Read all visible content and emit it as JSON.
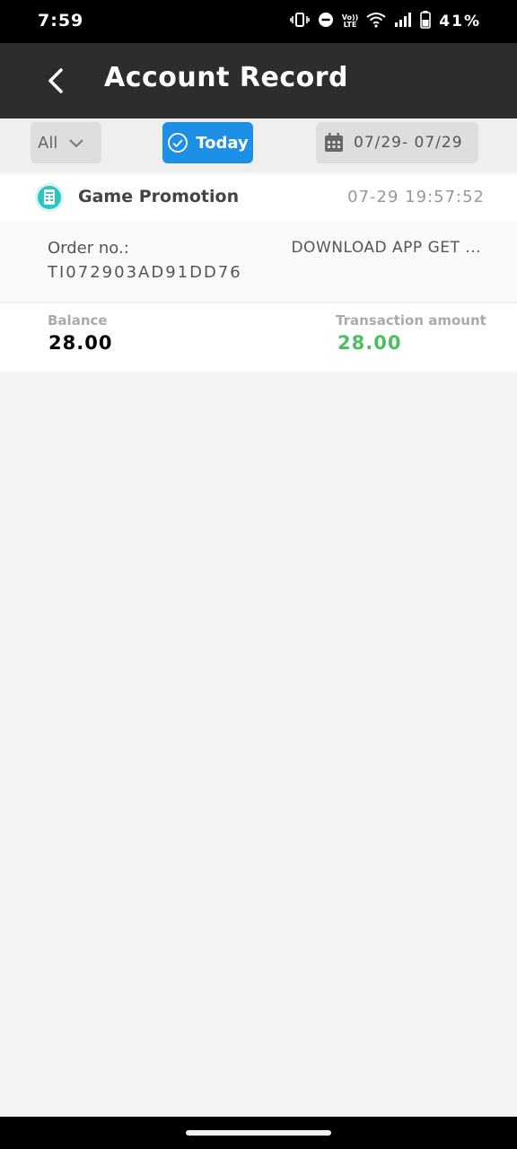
{
  "status_bar": {
    "time": "7:59",
    "lte_top": "Vo))",
    "lte_bottom": "LTE",
    "battery_percent": "41%",
    "icons": [
      "vibrate-icon",
      "do-not-disturb-icon",
      "volte-icon",
      "wifi-icon",
      "signal-icon",
      "battery-icon"
    ]
  },
  "app_bar": {
    "title": "Account Record",
    "back_icon": "chevron-left-icon"
  },
  "filters": {
    "type_label": "All",
    "today_label": "Today",
    "date_range": "07/29- 07/29",
    "colors": {
      "active": "#1d90e6",
      "inactive": "#dedede"
    }
  },
  "records": [
    {
      "title": "Game Promotion",
      "icon": "receipt-icon",
      "time": "07-29 19:57:52",
      "order_label": "Order no.:",
      "order_no": "TI072903AD91DD76",
      "description": "DOWNLOAD APP GET ...",
      "balance_label": "Balance",
      "balance_value": "28.00",
      "amount_label": "Transaction amount",
      "amount_value": "28.00",
      "amount_color": "#4cbf61"
    }
  ]
}
